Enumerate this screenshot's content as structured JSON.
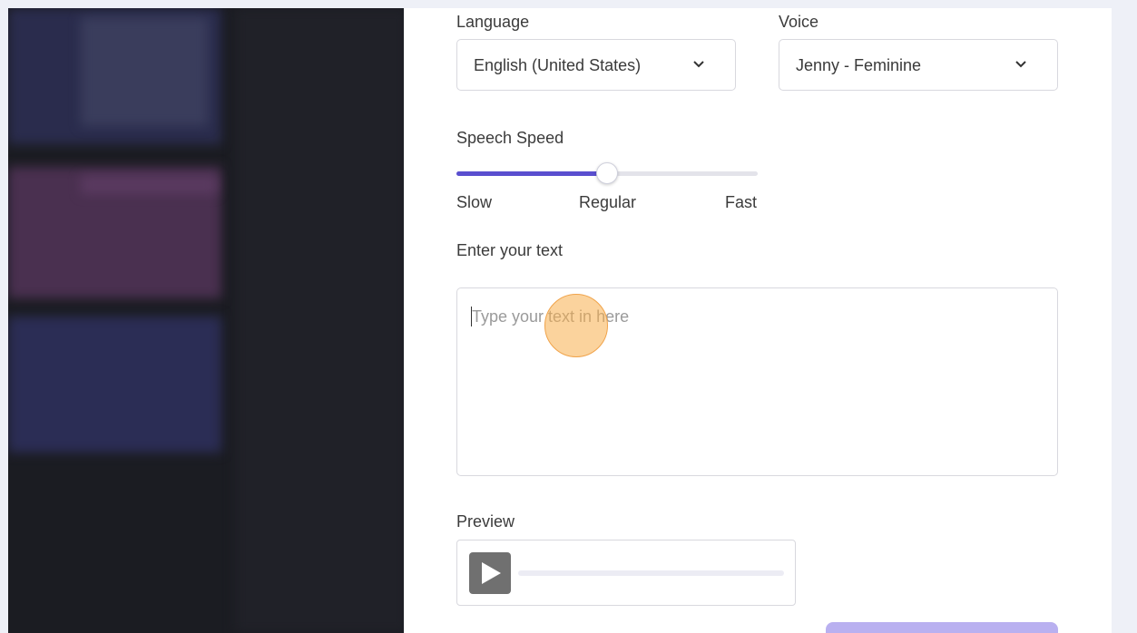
{
  "dialog": {
    "language": {
      "label": "Language",
      "value": "English (United States)"
    },
    "voice": {
      "label": "Voice",
      "value": "Jenny - Feminine"
    },
    "speech_speed": {
      "label": "Speech Speed",
      "value_fraction": 0.5,
      "ticks": [
        "Slow",
        "Regular",
        "Fast"
      ]
    },
    "text_input": {
      "label": "Enter your text",
      "placeholder": "Type your text in here"
    },
    "preview": {
      "label": "Preview",
      "progress_fraction": 0
    }
  },
  "colors": {
    "accent": "#5a4fcf",
    "click_marker": "#f7ae4c",
    "cta_disabled": "#b9b0f0"
  }
}
